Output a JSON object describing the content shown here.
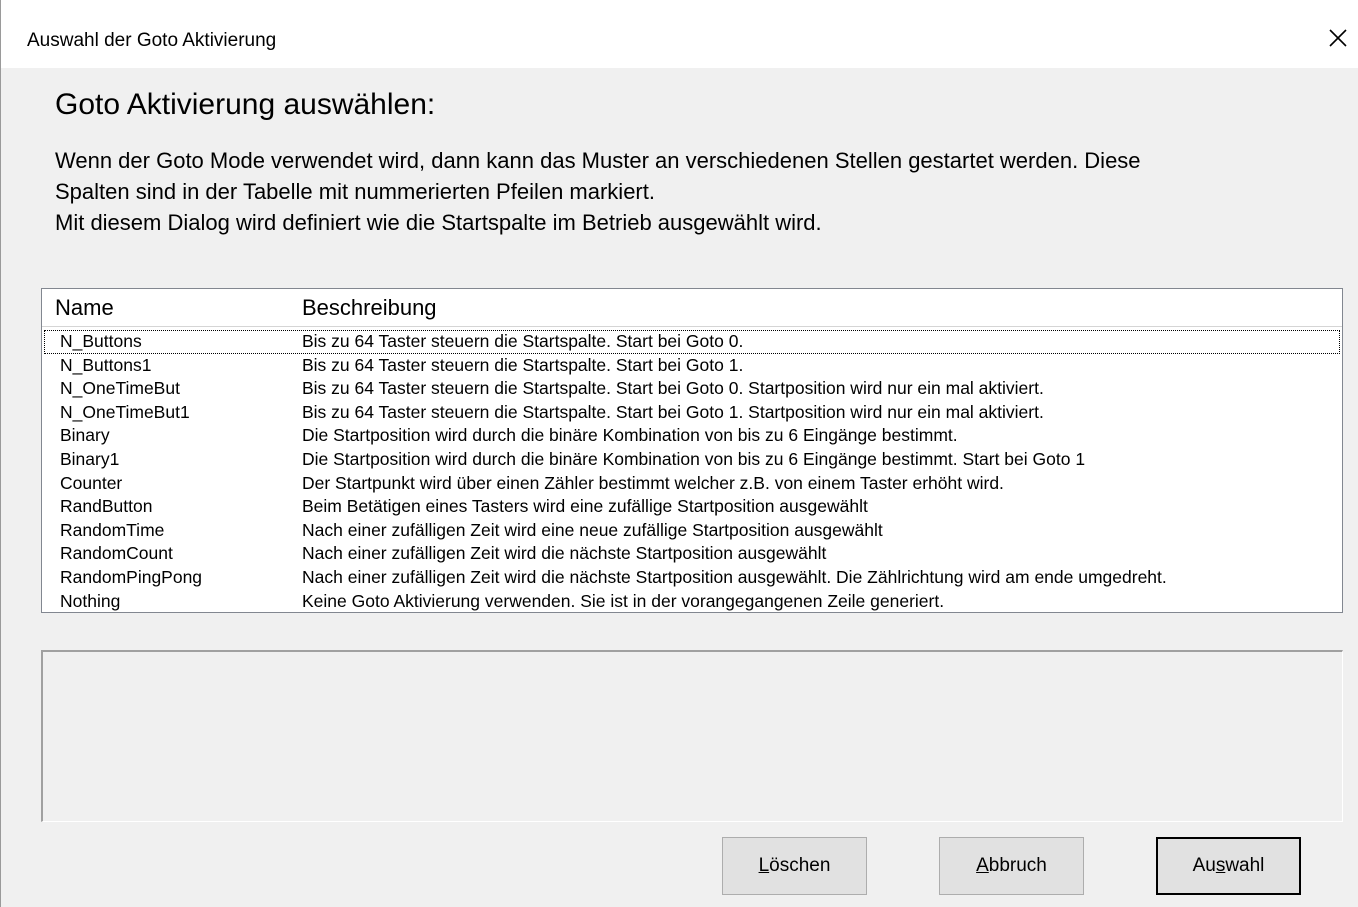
{
  "window": {
    "title": "Auswahl der Goto Aktivierung"
  },
  "heading": "Goto Aktivierung auswählen:",
  "description": [
    "Wenn der Goto Mode verwendet wird, dann kann das Muster an verschiedenen Stellen gestartet werden. Diese",
    "Spalten sind in der Tabelle mit nummerierten Pfeilen markiert.",
    "Mit diesem Dialog wird definiert wie die Startspalte im Betrieb ausgewählt wird."
  ],
  "list": {
    "columns": [
      "Name",
      "Beschreibung"
    ],
    "focused_index": 0,
    "rows": [
      {
        "name": "N_Buttons",
        "desc": "Bis zu 64 Taster steuern die Startspalte. Start bei Goto 0."
      },
      {
        "name": "N_Buttons1",
        "desc": "Bis zu 64 Taster steuern die Startspalte. Start bei Goto 1."
      },
      {
        "name": "N_OneTimeBut",
        "desc": "Bis zu 64 Taster steuern die Startspalte. Start bei Goto 0. Startposition wird nur ein mal aktiviert."
      },
      {
        "name": "N_OneTimeBut1",
        "desc": "Bis zu 64 Taster steuern die Startspalte. Start bei Goto 1.  Startposition wird nur ein mal aktiviert."
      },
      {
        "name": "Binary",
        "desc": "Die Startposition wird durch die binäre Kombination von bis zu 6 Eingänge bestimmt."
      },
      {
        "name": "Binary1",
        "desc": "Die Startposition wird durch die binäre Kombination von bis zu 6 Eingänge bestimmt. Start bei Goto 1"
      },
      {
        "name": "Counter",
        "desc": "Der Startpunkt wird über einen Zähler bestimmt welcher z.B. von einem Taster erhöht wird."
      },
      {
        "name": "RandButton",
        "desc": "Beim Betätigen eines Tasters wird eine zufällige Startposition ausgewählt"
      },
      {
        "name": "RandomTime",
        "desc": "Nach einer zufälligen Zeit wird eine neue zufällige Startposition ausgewählt"
      },
      {
        "name": "RandomCount",
        "desc": "Nach einer zufälligen Zeit wird die nächste Startposition ausgewählt"
      },
      {
        "name": "RandomPingPong",
        "desc": "Nach einer zufälligen Zeit wird die nächste Startposition ausgewählt. Die Zählrichtung wird am ende umgedreht."
      },
      {
        "name": "Nothing",
        "desc": "Keine Goto Aktivierung verwenden. Sie ist in der vorangegangenen Zeile generiert."
      }
    ]
  },
  "detail_text": "",
  "buttons": {
    "delete": {
      "accel": "L",
      "rest": "öschen"
    },
    "cancel": {
      "accel": "A",
      "rest": "bbruch"
    },
    "select": {
      "pre": "Au",
      "accel": "s",
      "rest": "wahl"
    }
  },
  "icons": {
    "close": "close-icon"
  }
}
